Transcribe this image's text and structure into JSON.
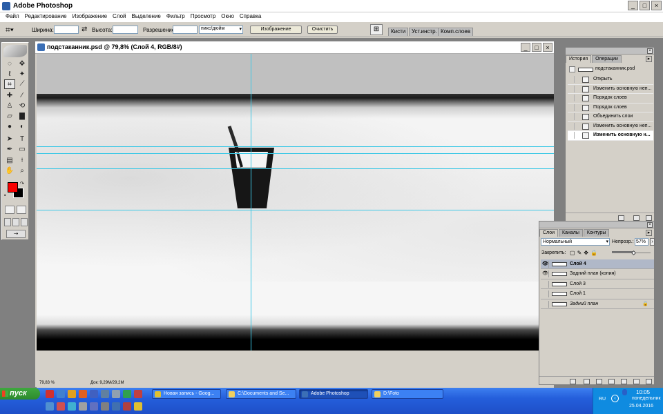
{
  "app": {
    "title": "Adobe Photoshop",
    "window_buttons": [
      "_",
      "□",
      "×"
    ]
  },
  "menu": [
    "Файл",
    "Редактирование",
    "Изображение",
    "Слой",
    "Выделение",
    "Фильтр",
    "Просмотр",
    "Окно",
    "Справка"
  ],
  "options_bar": {
    "width_label": "Ширина:",
    "height_label": "Высота:",
    "resolution_label": "Разрешение:",
    "units_value": "пикс/дюйм",
    "image_button": "Изображение",
    "clear_button": "Очистить",
    "palette_tabs": [
      "Кисти",
      "Уст.инстр.",
      "Комп.слоев"
    ]
  },
  "document": {
    "title": "подстаканник.psd @ 79,8% (Слой 4, RGB/8#)",
    "zoom": "79,83 %",
    "doc_info": "Док: 9,29М/29,2М",
    "window_buttons": [
      "_",
      "□",
      "×"
    ]
  },
  "history_panel": {
    "tabs": [
      "История",
      "Операции"
    ],
    "active_tab": "История",
    "snapshot": "подстаканник.psd",
    "steps": [
      "Открыть",
      "Изменить основную неп...",
      "Порядок слоев",
      "Порядок слоев",
      "Объединить слои",
      "Изменить основную неп...",
      "Изменить основную н..."
    ],
    "current_step_index": 6
  },
  "layers_panel": {
    "tabs": [
      "Слои",
      "Каналы",
      "Контуры"
    ],
    "active_tab": "Слои",
    "blend_mode": "Нормальный",
    "opacity_label": "Непрозр.:",
    "opacity": "57%",
    "opacity_fraction": 0.57,
    "lock_label": "Закрепить:",
    "layers": [
      {
        "name": "Слой 4",
        "visible": true,
        "active": true
      },
      {
        "name": "Задний план (копия)",
        "visible": true,
        "active": false
      },
      {
        "name": "Слой 3",
        "visible": false,
        "active": false
      },
      {
        "name": "Слой 1",
        "visible": false,
        "active": false
      },
      {
        "name": "Задний план",
        "visible": false,
        "active": false,
        "locked": true
      }
    ]
  },
  "taskbar": {
    "start": "пуск",
    "tasks": [
      "Новая запись - Goog...",
      "C:\\Documents and Se...",
      "Adobe Photoshop",
      "D:\\Foto"
    ],
    "active_task": "Adobe Photoshop",
    "lang": "RU",
    "time": "10:05",
    "day": "понедельник",
    "date": "25.04.2016"
  },
  "colors": {
    "foreground": "#f80000",
    "background": "#000000",
    "guide": "#3cc8e6",
    "taskbar": "#245edb"
  }
}
